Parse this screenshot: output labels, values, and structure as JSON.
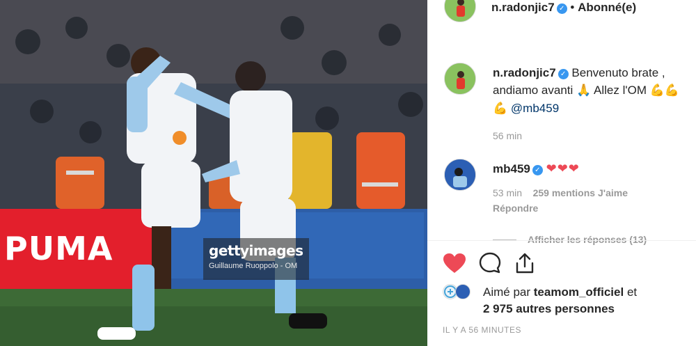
{
  "photo": {
    "sponsor_text": "PUMA",
    "watermark_brand": "gettyimages",
    "watermark_credit": "Guillaume Ruoppolo - OM"
  },
  "header": {
    "username": "n.radonjic7",
    "separator": "•",
    "follow_status": "Abonné(e)"
  },
  "comments": [
    {
      "username": "n.radonjic7",
      "line1": "Benvenuto brate ,",
      "line2": "andiamo avanti",
      "line2_rest": "Allez l'OM",
      "mention": "@mb459",
      "time": "56 min"
    },
    {
      "username": "mb459",
      "time": "53 min",
      "likes": "259 mentions J'aime",
      "reply": "Répondre"
    }
  ],
  "more_replies": "Afficher les réponses (13)",
  "likes": {
    "prefix": "Aimé par",
    "account": "teamom_officiel",
    "conjunction": "et",
    "others": "2 975 autres personnes"
  },
  "timestamp": "IL Y A 56 MINUTES",
  "colors": {
    "heart": "#ed4956",
    "verified": "#3897f0",
    "mention": "#003569",
    "muted": "#999999"
  }
}
